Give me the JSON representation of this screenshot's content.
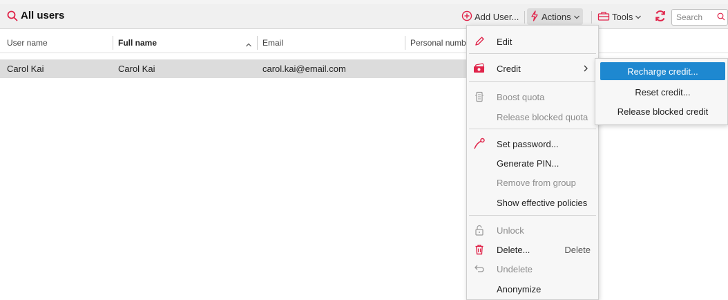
{
  "toolbar": {
    "title": "All users",
    "add_user_label": "Add User...",
    "actions_label": "Actions",
    "tools_label": "Tools",
    "search_placeholder": "Search"
  },
  "grid": {
    "columns": [
      "User name",
      "Full name",
      "Email",
      "Personal numbe"
    ],
    "rows": [
      {
        "user_name": "Carol Kai",
        "full_name": "Carol Kai",
        "email": "carol.kai@email.com",
        "personal_number": ""
      }
    ]
  },
  "actions_menu": {
    "items": [
      {
        "label": "Edit",
        "icon": "pencil-icon",
        "enabled": true
      },
      {
        "label": "Credit",
        "icon": "credit-card-icon",
        "enabled": true,
        "has_submenu": true
      },
      {
        "label": "Boost quota",
        "icon": "boost-quota-icon",
        "enabled": false
      },
      {
        "label": "Release blocked quota",
        "icon": "",
        "enabled": false
      },
      {
        "label": "Set password...",
        "icon": "key-icon",
        "enabled": true
      },
      {
        "label": "Generate PIN...",
        "icon": "",
        "enabled": true
      },
      {
        "label": "Remove from group",
        "icon": "",
        "enabled": false
      },
      {
        "label": "Show effective policies",
        "icon": "",
        "enabled": true
      },
      {
        "label": "Unlock",
        "icon": "unlock-icon",
        "enabled": false
      },
      {
        "label": "Delete...",
        "icon": "trash-icon",
        "enabled": true,
        "shortcut": "Delete"
      },
      {
        "label": "Undelete",
        "icon": "undo-icon",
        "enabled": false
      },
      {
        "label": "Anonymize",
        "icon": "",
        "enabled": true
      }
    ]
  },
  "credit_submenu": {
    "items": [
      {
        "label": "Recharge credit...",
        "selected": true
      },
      {
        "label": "Reset credit...",
        "selected": false
      },
      {
        "label": "Release blocked credit",
        "selected": false
      }
    ]
  },
  "colors": {
    "accent_red": "#e0244a",
    "selection_blue": "#1e88d0",
    "row_selected": "#dcdcdc"
  }
}
